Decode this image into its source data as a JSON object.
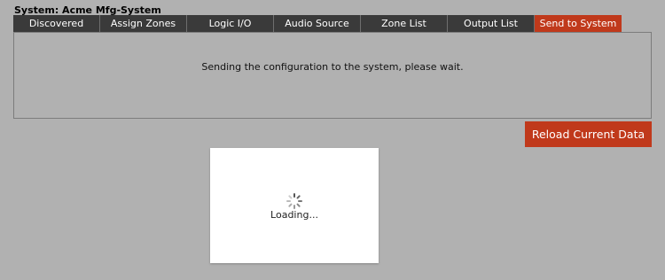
{
  "header": {
    "system_title": "System: Acme Mfg-System"
  },
  "tabs": [
    {
      "label": "Discovered Devices",
      "active": false
    },
    {
      "label": "Assign Zones",
      "active": false
    },
    {
      "label": "Logic I/O",
      "active": false
    },
    {
      "label": "Audio Source",
      "active": false
    },
    {
      "label": "Zone List",
      "active": false
    },
    {
      "label": "Output List",
      "active": false
    },
    {
      "label": "Send to System",
      "active": true
    }
  ],
  "panel": {
    "message": "Sending the configuration to the system, please wait."
  },
  "actions": {
    "reload_label": "Reload Current Data"
  },
  "loading": {
    "text": "Loading...",
    "icon": "spinner-icon"
  },
  "colors": {
    "accent": "#c0391b",
    "tab_bg": "#3a3a3a",
    "page_bg": "#b1b1b1"
  }
}
